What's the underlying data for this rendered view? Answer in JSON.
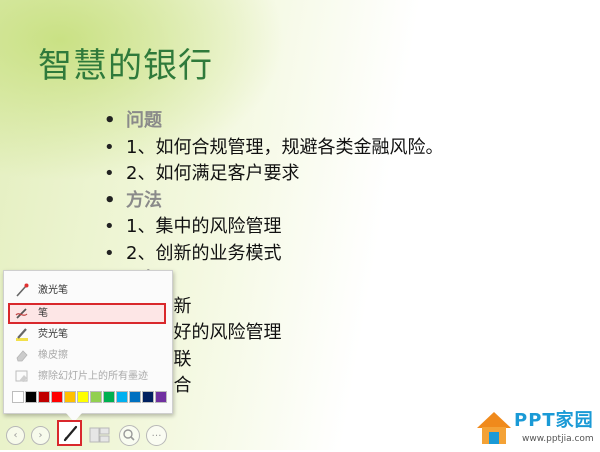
{
  "slide": {
    "title": "智慧的银行",
    "bullets": [
      {
        "text": "问题",
        "head": true
      },
      {
        "text": "1、如何合规管理，规避各类金融风险。",
        "head": false
      },
      {
        "text": "2、如何满足客户要求",
        "head": false
      },
      {
        "text": "方法",
        "head": true
      },
      {
        "text": "1、集中的风险管理",
        "head": false
      },
      {
        "text": "2、创新的业务模式",
        "head": false
      },
      {
        "text": "目标",
        "head": true
      },
      {
        "text": "1、创新",
        "head": false
      },
      {
        "text": "2、更好的风险管理",
        "head": false
      },
      {
        "text": "3、互联",
        "head": false
      },
      {
        "text": "4、整合",
        "head": false
      }
    ],
    "bullet_glyph": "•"
  },
  "pen_menu": {
    "items": [
      {
        "label": "激光笔",
        "icon": "laser-pointer-icon",
        "selected": false,
        "disabled": false
      },
      {
        "label": "笔",
        "icon": "pen-icon",
        "selected": true,
        "disabled": false
      },
      {
        "label": "荧光笔",
        "icon": "highlighter-icon",
        "selected": false,
        "disabled": false
      },
      {
        "label": "橡皮擦",
        "icon": "eraser-icon",
        "selected": false,
        "disabled": true
      },
      {
        "label": "擦除幻灯片上的所有墨迹",
        "icon": "erase-all-ink-icon",
        "selected": false,
        "disabled": true
      }
    ],
    "colors": [
      "#ffffff",
      "#000000",
      "#c00000",
      "#ff0000",
      "#ffc000",
      "#ffff00",
      "#92d050",
      "#00b050",
      "#00b0f0",
      "#0070c0",
      "#002060",
      "#7030a0"
    ],
    "accent": "#d9282c"
  },
  "toolbar": {
    "prev_glyph": "‹",
    "next_glyph": "›",
    "more_glyph": "…"
  },
  "watermark": {
    "cn_text": "PPT家园",
    "url_text": "www.pptjia.com"
  }
}
